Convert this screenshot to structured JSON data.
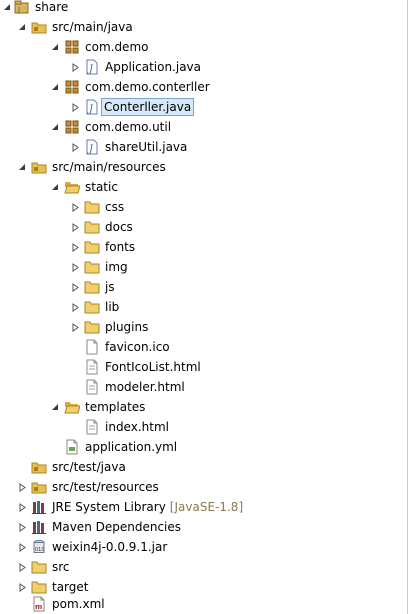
{
  "tree": {
    "root": "share",
    "src_main_java": "src/main/java",
    "pkg_demo": "com.demo",
    "file_application_java": "Application.java",
    "pkg_conterller": "com.demo.conterller",
    "file_conterller_java": "Conterller.java",
    "pkg_util": "com.demo.util",
    "file_shareutil_java": "shareUtil.java",
    "src_main_resources": "src/main/resources",
    "folder_static": "static",
    "folder_css": "css",
    "folder_docs": "docs",
    "folder_fonts": "fonts",
    "folder_img": "img",
    "folder_js": "js",
    "folder_lib": "lib",
    "folder_plugins": "plugins",
    "file_favicon": "favicon.ico",
    "file_fonticolist": "FontIcoList.html",
    "file_modeler": "modeler.html",
    "folder_templates": "templates",
    "file_index": "index.html",
    "file_application_yml": "application.yml",
    "src_test_java": "src/test/java",
    "src_test_resources": "src/test/resources",
    "jre_library": "JRE System Library",
    "jre_version": "[JavaSE-1.8]",
    "maven_deps": "Maven Dependencies",
    "jar_weixin": "weixin4j-0.0.9.1.jar",
    "folder_src": "src",
    "folder_target": "target",
    "file_pom": "pom.xml"
  },
  "colors": {
    "selection_bg": "#d6e9fb",
    "selection_border": "#7da2ce",
    "folder": "#e8c14c",
    "package": "#b07a2a",
    "java_file": "#3c6db5"
  }
}
